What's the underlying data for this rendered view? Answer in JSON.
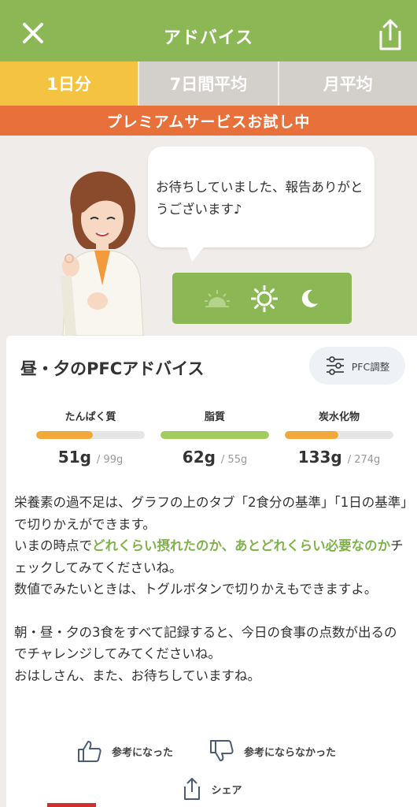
{
  "header": {
    "title": "アドバイス"
  },
  "tabs": [
    {
      "label": "1日分",
      "active": true
    },
    {
      "label": "7日間平均",
      "active": false
    },
    {
      "label": "月平均",
      "active": false
    }
  ],
  "banner": {
    "text": "プレミアムサービスお試し中"
  },
  "advisor": {
    "message": "お待ちしていました、報告ありがとうございます♪"
  },
  "meal_toggle": {
    "icons": [
      "sunrise-icon",
      "sun-icon",
      "moon-icon"
    ]
  },
  "card": {
    "title": "昼・夕のPFCアドバイス",
    "pfc_button_label": "PFC調整",
    "nutrients": [
      {
        "label": "たんぱく質",
        "value": "51g",
        "target": "/ 99g",
        "progress": 0.52,
        "color": "#f0a93a"
      },
      {
        "label": "脂質",
        "value": "62g",
        "target": "/ 55g",
        "progress": 1.0,
        "color": "#a3cc5e"
      },
      {
        "label": "炭水化物",
        "value": "133g",
        "target": "/ 274g",
        "progress": 0.49,
        "color": "#f0a93a"
      }
    ],
    "text": {
      "p1": "栄養素の過不足は、グラフの上のタブ「2食分の基準」「1日の基準」で切りかえができます。",
      "p2_pre": "いまの時点で",
      "p2_highlight": "どれくらい摂れたのか、あとどれくらい必要なのか",
      "p2_post": "チェックしてみてくださいね。",
      "p3": "数値でみたいときは、トグルボタンで切りかえもできますよ。",
      "p4": "朝・昼・夕の3食をすべて記録すると、今日の食事の点数が出るのでチャレンジしてみてくださいね。",
      "p5": "おはしさん、また、お待ちしていますね。"
    },
    "feedback": {
      "helpful_label": "参考になった",
      "not_helpful_label": "参考にならなかった",
      "share_label": "シェア"
    }
  },
  "colors": {
    "header_green": "#8bb854",
    "tab_active": "#f5c342",
    "tab_inactive": "#d3cfca",
    "banner_orange": "#e8703a",
    "highlight_green": "#7fb24a"
  }
}
